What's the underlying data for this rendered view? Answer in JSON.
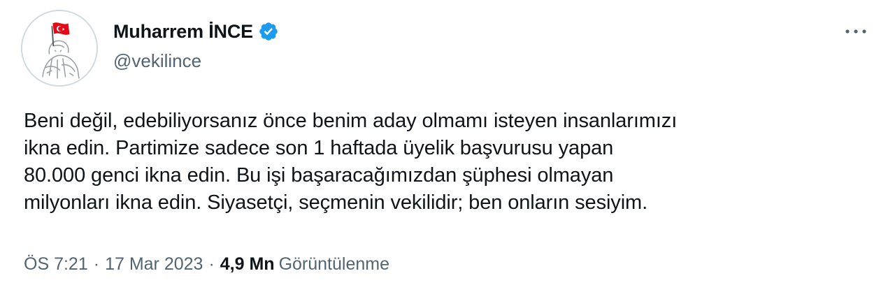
{
  "author": {
    "display_name": "Muharrem İNCE",
    "handle": "@vekilince",
    "verified_badge_color": "#1d9bf0"
  },
  "tweet": {
    "lines": [
      "Beni değil, edebiliyorsanız önce benim aday olmamı isteyen insanlarımızı",
      "ikna edin. Partimize sadece son 1 haftada üyelik başvurusu yapan",
      "80.000 genci ikna edin. Bu işi başaracağımızdan şüphesi olmayan",
      "milyonları ikna edin.  Siyasetçi, seçmenin vekilidir; ben onların sesiyim."
    ]
  },
  "meta": {
    "time": "ÖS 7:21",
    "separator": "·",
    "date": "17 Mar 2023",
    "views_count": "4,9 Mn",
    "views_label": "Görüntülenme"
  },
  "icons": {
    "avatar": "profile-avatar-flag",
    "verified": "verified-badge-icon",
    "more": "more-options-icon"
  },
  "colors": {
    "text_primary": "#0f1419",
    "text_secondary": "#536471",
    "accent": "#1d9bf0",
    "flag_red": "#e30a17"
  }
}
